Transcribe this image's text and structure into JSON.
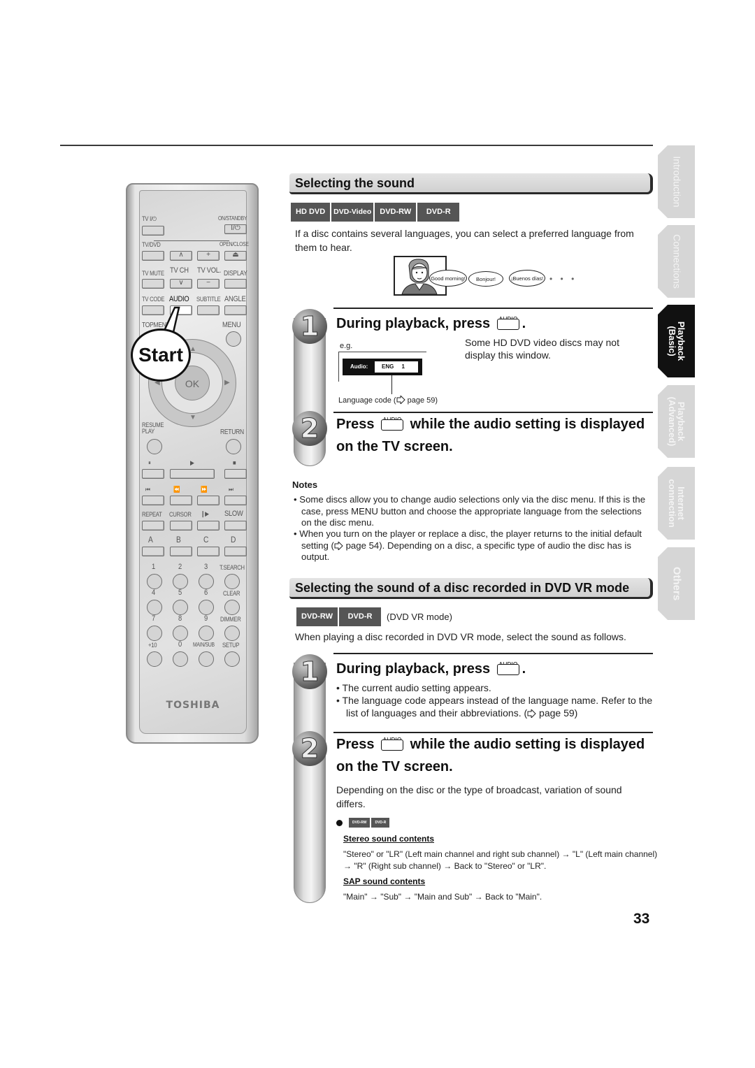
{
  "remote": {
    "labels": {
      "tv_power": "TV I/⏻",
      "on_standby": "ON/STANDBY",
      "on_standby_key": "I/⏻",
      "tv_dvd": "TV/DVD",
      "open_close": "OPEN/CLOSE",
      "tv_mute": "TV MUTE",
      "tv_ch": "TV CH",
      "tv_vol": "TV VOL.",
      "display": "DISPLAY",
      "tv_code": "TV CODE",
      "audio": "AUDIO",
      "subtitle": "SUBTITLE",
      "angle": "ANGLE",
      "top_menu": "TOPMENU",
      "menu": "MENU",
      "ok": "OK",
      "resume_play": "RESUME\nPLAY",
      "return": "RETURN",
      "repeat": "REPEAT",
      "cursor": "CURSOR",
      "slow": "SLOW",
      "a": "A",
      "b": "B",
      "c": "C",
      "d": "D",
      "num1": "1",
      "num2": "2",
      "num3": "3",
      "t_search": "T.SEARCH",
      "num4": "4",
      "num5": "5",
      "num6": "6",
      "clear": "CLEAR",
      "num7": "7",
      "num8": "8",
      "num9": "9",
      "dimmer": "DIMMER",
      "plus10": "+10",
      "num0": "0",
      "main_sub": "MAIN/SUB",
      "setup": "SETUP"
    },
    "glyphs": {
      "ch_up": "∧",
      "ch_down": "∨",
      "vol_up": "+",
      "vol_down": "−",
      "eject": "⏏",
      "pause": "⏸",
      "play": "▶",
      "stop": "■",
      "skip_back": "⏮",
      "rewind": "⏪",
      "fast_forward": "⏩",
      "skip_forward": "⏭",
      "frame_advance": "❙▶"
    },
    "brand": "TOSHIBA",
    "callout": "Start"
  },
  "section1": {
    "title": "Selecting the sound",
    "discs": [
      "HD DVD",
      "DVD-Video",
      "DVD-RW",
      "DVD-R"
    ],
    "intro": "If a disc contains several languages, you can select a preferred language from them to hear.",
    "illustration": {
      "bubbles": [
        "Good morning!",
        "Bonjour!",
        "¡Buenos días!"
      ],
      "ellipsis": "• • •"
    },
    "step1": {
      "number": "1",
      "title_before": "During playback, press",
      "key_label": "AUDIO",
      "title_after": ".",
      "eg": "e.g.",
      "osd_label": "Audio:",
      "osd_value": "ENG     1",
      "caption": "Language code (",
      "caption_ref": " page 59)",
      "side_note": "Some HD DVD video discs may not display this window."
    },
    "step2": {
      "number": "2",
      "title_before": "Press",
      "key_label": "AUDIO",
      "title_after": "while the audio setting is displayed",
      "title_line2": "on the TV screen."
    },
    "notes": {
      "title": "Notes",
      "items": [
        "• Some discs allow you to change audio selections only via the disc menu. If this is the case, press MENU button and choose the appropriate language from the selections on the disc menu.",
        "• When you turn on the player or replace a disc, the player returns to the initial default setting (",
        " page 54). Depending on a disc, a specific type of audio the disc has is output."
      ]
    }
  },
  "section2": {
    "title": "Selecting the sound of a disc recorded in DVD VR mode",
    "discs": [
      "DVD-RW",
      "DVD-R"
    ],
    "disc_note": "(DVD VR mode)",
    "intro": "When playing a disc recorded in DVD VR mode, select the sound as follows.",
    "step1": {
      "number": "1",
      "title_before": "During playback, press",
      "key_label": "AUDIO",
      "title_after": ".",
      "bullets": [
        "•  The current audio setting appears.",
        "•  The language code appears instead of the language name. Refer to the list of languages and their abbreviations. ("
      ],
      "bullet_ref": " page 59)"
    },
    "step2": {
      "number": "2",
      "title_before": "Press",
      "key_label": "AUDIO",
      "title_after": "while the audio setting is displayed",
      "title_line2": "on the TV screen.",
      "body": "Depending on the disc or the type of broadcast, variation of sound differs.",
      "mini_discs": [
        "DVD-RW",
        "DVD-R"
      ],
      "stereo_heading": "Stereo sound contents",
      "stereo_text": "\"Stereo\" or \"LR\" (Left main channel and right sub channel) → \"L\" (Left main channel) → \"R\" (Right sub channel) → Back to \"Stereo\" or \"LR\".",
      "sap_heading": "SAP sound contents",
      "sap_text": "\"Main\" → \"Sub\" → \"Main and Sub\" → Back to \"Main\"."
    }
  },
  "page_number": "33",
  "side_tabs": [
    {
      "label": "Introduction",
      "active": false
    },
    {
      "label": "Connections",
      "active": false
    },
    {
      "label": "Playback\n(Basic)",
      "active": true
    },
    {
      "label": "Playback\n(Advanced)",
      "active": false
    },
    {
      "label": "Internet\nconnection",
      "active": false
    },
    {
      "label": "Others",
      "active": false
    }
  ],
  "colors": {
    "disc_tag_bg": "#555555",
    "active_tab_bg": "#111111",
    "inactive_tab_bg": "#d6d6d6"
  }
}
